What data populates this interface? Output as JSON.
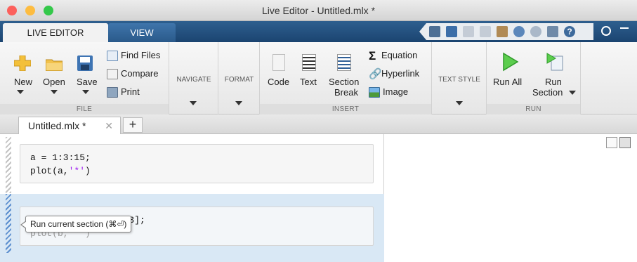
{
  "window": {
    "title": "Live Editor - Untitled.mlx *",
    "traffic_colors": [
      "#fc605c",
      "#fdbc40",
      "#34c84a"
    ]
  },
  "ribbon_tabs": [
    {
      "label": "LIVE EDITOR",
      "active": true
    },
    {
      "label": "VIEW",
      "active": false
    }
  ],
  "quick_access_icons": [
    "new-window-icon",
    "save-icon",
    "cut-icon",
    "copy-icon",
    "paste-icon",
    "undo-icon",
    "redo-icon",
    "dock-icon",
    "help-icon",
    "menu-icon",
    "pin-icon"
  ],
  "groups": {
    "file": {
      "label": "FILE",
      "new": "New",
      "open": "Open",
      "save": "Save",
      "find_files": "Find Files",
      "compare": "Compare",
      "print": "Print"
    },
    "navigate": {
      "label": "NAVIGATE"
    },
    "format": {
      "label": "FORMAT"
    },
    "insert": {
      "label": "INSERT",
      "code": "Code",
      "text": "Text",
      "section_line1": "Section",
      "section_line2": "Break",
      "equation": "Equation",
      "hyperlink": "Hyperlink",
      "image": "Image"
    },
    "text_style": {
      "label": "TEXT STYLE"
    },
    "run": {
      "label": "RUN",
      "run_all": "Run All",
      "run_section_line1": "Run",
      "run_section_line2": "Section"
    }
  },
  "document_tab": {
    "name": "Untitled.mlx *",
    "close": "✕",
    "add": "+"
  },
  "code": {
    "section1": {
      "line1": "a = 1:3:15;",
      "line2_prefix": "plot(a,",
      "line2_string": "'*'",
      "line2_suffix": ")"
    },
    "section2": {
      "line1": "b = [1 11 22 0 6 33];",
      "line2": "plot(b,'*')"
    }
  },
  "tooltip": {
    "text": "Run current section (⌘⏎)"
  },
  "colors": {
    "tab_bar": "#1b4470",
    "active_section": "#d9e8f5",
    "run_green": "#4cc046",
    "string_purple": "#a020f0"
  }
}
